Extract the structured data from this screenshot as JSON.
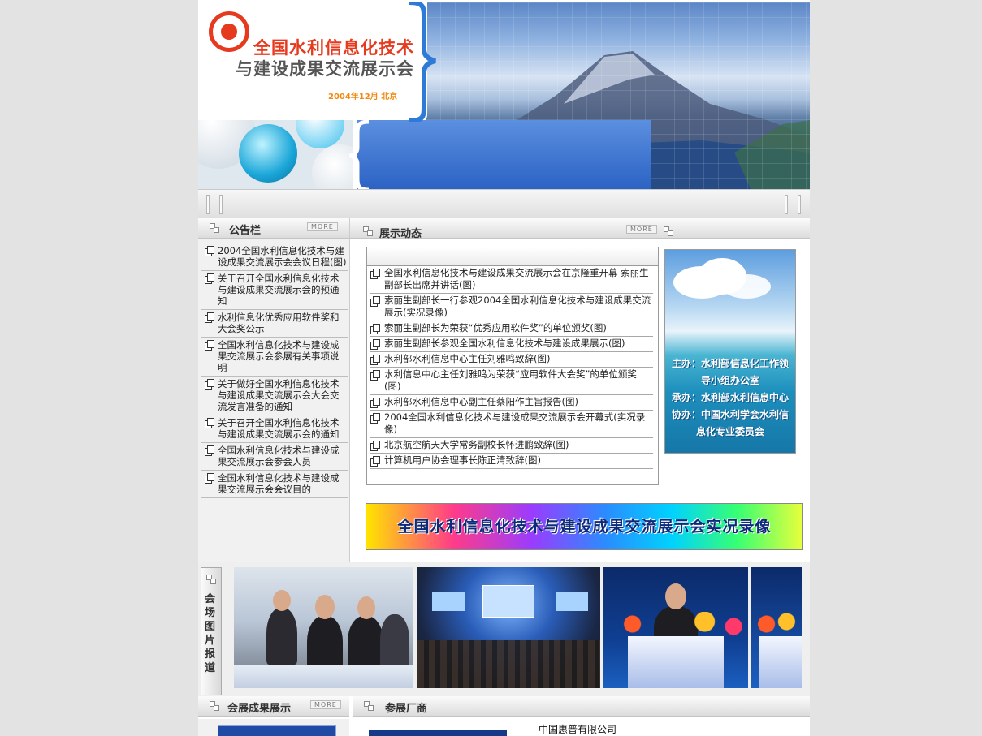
{
  "banner": {
    "title_line1": "全国水利信息化技术",
    "title_line2": "与建设成果交流展示会",
    "date_place": "2004年12月  北京"
  },
  "notice_board": {
    "title": "公告栏",
    "more": "MORE",
    "items": [
      "2004全国水利信息化技术与建设成果交流展示会会议日程(图)",
      "关于召开全国水利信息化技术与建设成果交流展示会的预通知",
      "水利信息化优秀应用软件奖和大会奖公示",
      "全国水利信息化技术与建设成果交流展示会参展有关事项说明",
      "关于做好全国水利信息化技术与建设成果交流展示会大会交流发言准备的通知",
      "关于召开全国水利信息化技术与建设成果交流展示会的通知",
      "全国水利信息化技术与建设成果交流展示会参会人员",
      "全国水利信息化技术与建设成果交流展示会会议目的"
    ]
  },
  "exhibition_news": {
    "title": "展示动态",
    "more": "MORE",
    "items": [
      "全国水利信息化技术与建设成果交流展示会在京隆重开幕  索丽生副部长出席并讲话(图)",
      "索丽生副部长一行参观2004全国水利信息化技术与建设成果交流展示(实况录像)",
      "索丽生副部长为荣获“优秀应用软件奖”的单位颁奖(图)",
      "索丽生副部长参观全国水利信息化技术与建设成果展示(图)",
      "水利部水利信息中心主任刘雅鸣致辞(图)",
      "水利信息中心主任刘雅鸣为荣获“应用软件大会奖”的单位颁奖(图)",
      "水利部水利信息中心副主任蔡阳作主旨报告(图)",
      "2004全国水利信息化技术与建设成果交流展示会开幕式(实况录像)",
      "北京航空航天大学常务副校长怀进鹏致辞(图)",
      "计算机用户协会理事长陈正清致辞(图)"
    ]
  },
  "organizers": {
    "lines": [
      "主办：水利部信息化工作领",
      "导小组办公室",
      "承办：水利部水利信息中心",
      "协办：中国水利学会水利信",
      "息化专业委员会"
    ]
  },
  "video_banner": {
    "text": "全国水利信息化技术与建设成果交流展示会实况录像"
  },
  "photo_report": {
    "label": "会场图片报道"
  },
  "bottom": {
    "achievements_title": "会展成果展示",
    "achievements_more": "MORE",
    "exhibitors_title": "参展厂商",
    "company": "中国惠普有限公司"
  }
}
